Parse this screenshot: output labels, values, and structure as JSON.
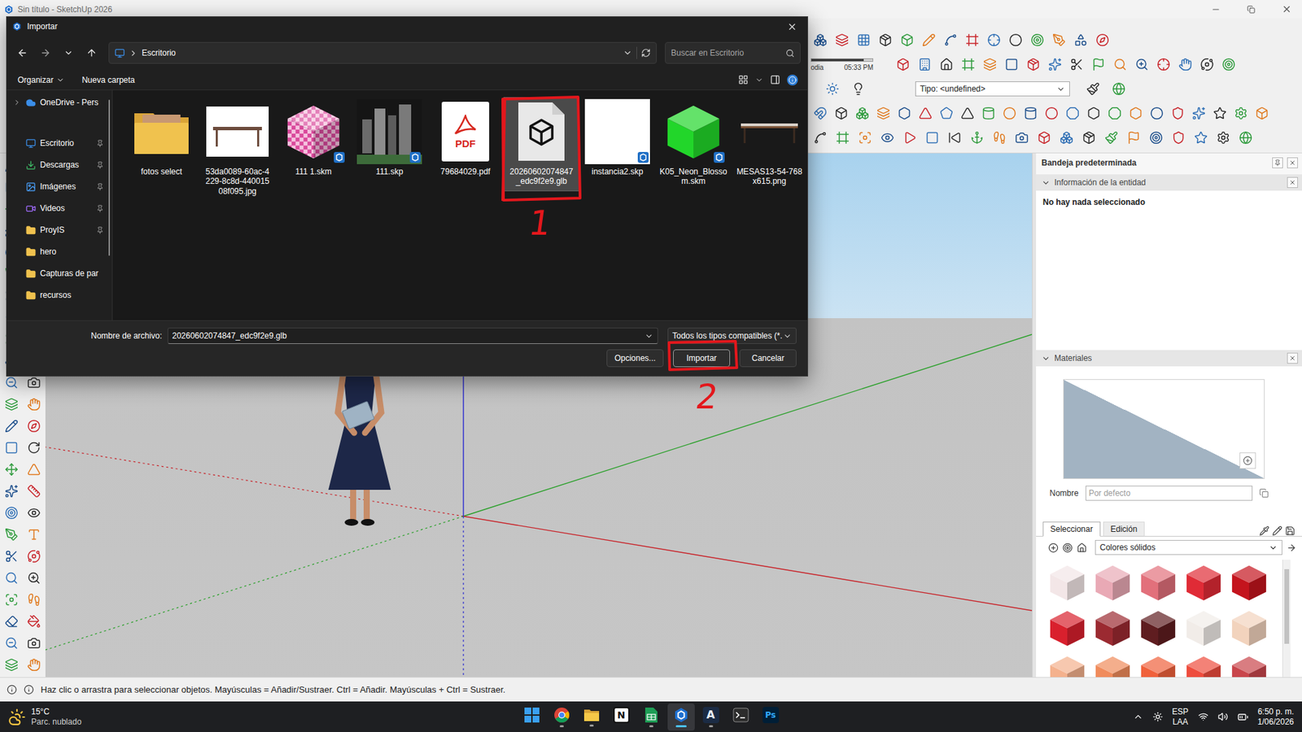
{
  "window": {
    "title": "Sin título - SketchUp 2026"
  },
  "toolbar": {
    "shadow": {
      "label": "odia",
      "time": "05:33 PM",
      "level": 0.85
    },
    "style_dropdown": "Tipo: <undefined>"
  },
  "tray": {
    "title": "Bandeja predeterminada",
    "entity_info": {
      "title": "Información de la entidad",
      "expanded": true,
      "message": "No hay nada seleccionado"
    },
    "materials": {
      "title": "Materiales",
      "expanded": true,
      "name_label": "Nombre",
      "name_placeholder": "Por defecto",
      "tabs": [
        {
          "label": "Seleccionar",
          "selected": true
        },
        {
          "label": "Edición",
          "selected": false
        }
      ],
      "library": "Colores sólidos",
      "swatches": [
        {
          "color": "#f3e6e7"
        },
        {
          "color": "#e9a9b5"
        },
        {
          "color": "#e2707b"
        },
        {
          "color": "#e02b36"
        },
        {
          "color": "#c4141d"
        },
        {
          "color": "#d9202d"
        },
        {
          "color": "#9b2a31"
        },
        {
          "color": "#5f1d20"
        },
        {
          "color": "#f1ece8"
        },
        {
          "color": "#f2d3bd"
        },
        {
          "color": "#f4b18d"
        },
        {
          "color": "#f08b5b"
        },
        {
          "color": "#f0613b"
        },
        {
          "color": "#ee4c3d"
        },
        {
          "color": "#c9454b"
        }
      ]
    }
  },
  "status_bar": {
    "message": "Haz clic o arrastra para seleccionar objetos. Mayúsculas = Añadir/Sustraer. Ctrl = Añadir. Mayúsculas + Ctrl = Sustraer."
  },
  "dialog": {
    "title": "Importar",
    "path": "Escritorio",
    "search_placeholder": "Buscar en Escritorio",
    "commands": [
      "Organizar",
      "Nueva carpeta"
    ],
    "sidebar": [
      {
        "label": "OneDrive - Pers",
        "kind": "cloud",
        "pinned": false,
        "expandable": true
      },
      {
        "label": "Escritorio",
        "kind": "desktop",
        "pinned": true,
        "expandable": false
      },
      {
        "label": "Descargas",
        "kind": "download",
        "pinned": true,
        "expandable": false
      },
      {
        "label": "Imágenes",
        "kind": "images",
        "pinned": true,
        "expandable": false
      },
      {
        "label": "Videos",
        "kind": "videos",
        "pinned": true,
        "expandable": false
      },
      {
        "label": "ProyIS",
        "kind": "folder",
        "pinned": true,
        "expandable": false
      },
      {
        "label": "hero",
        "kind": "folder",
        "pinned": false,
        "expandable": false
      },
      {
        "label": "Capturas de par",
        "kind": "folder",
        "pinned": false,
        "expandable": false
      },
      {
        "label": "recursos",
        "kind": "folder",
        "pinned": false,
        "expandable": false
      }
    ],
    "files": [
      {
        "name": "fotos select",
        "kind": "folder",
        "selected": false
      },
      {
        "name": "53da0089-60ac-4229-8c8d-44001508f095.jpg",
        "kind": "photo",
        "selected": false
      },
      {
        "name": "111 1.skm",
        "kind": "checker-material",
        "selected": false
      },
      {
        "name": "111.skp",
        "kind": "city-model",
        "selected": false
      },
      {
        "name": "79684029.pdf",
        "kind": "pdf",
        "badge": "PDF",
        "selected": false
      },
      {
        "name": "20260602074847_edc9f2e9.glb",
        "kind": "glb",
        "selected": true
      },
      {
        "name": "instancia2.skp",
        "kind": "blank-model",
        "selected": false
      },
      {
        "name": "K05_Neon_Blossom.skm",
        "kind": "green-material",
        "selected": false
      },
      {
        "name": "MESAS13-54-768x615.png",
        "kind": "table-image",
        "selected": false
      }
    ],
    "filename_label": "Nombre de archivo:",
    "filename": "20260602074847_edc9f2e9.glb",
    "filter": "Todos los tipos compatibles (*.",
    "buttons": [
      {
        "label": "Opciones...",
        "primary": false
      },
      {
        "label": "Importar",
        "primary": true
      },
      {
        "label": "Cancelar",
        "primary": false
      }
    ]
  },
  "annotations": [
    {
      "label": "1"
    },
    {
      "label": "2"
    }
  ],
  "taskbar": {
    "weather": {
      "temp": "15°C",
      "desc": "Parc. nublado"
    },
    "apps": [
      {
        "kind": "start",
        "running": false,
        "active": false
      },
      {
        "kind": "chrome",
        "running": true,
        "active": false
      },
      {
        "kind": "explorer",
        "running": true,
        "active": false
      },
      {
        "kind": "notion",
        "glyph": "N",
        "running": false,
        "active": false
      },
      {
        "kind": "sheet",
        "running": true,
        "active": false
      },
      {
        "kind": "sketchup",
        "running": true,
        "active": true
      },
      {
        "kind": "autocad",
        "glyph": "A",
        "running": true,
        "active": false
      },
      {
        "kind": "terminal",
        "running": false,
        "active": false
      },
      {
        "kind": "photoshop",
        "glyph": "Ps",
        "running": false,
        "active": false
      }
    ],
    "tray": {
      "lang": "ESP",
      "layout": "LAA",
      "time": "6:50 p. m.",
      "date": "1/06/2026"
    }
  }
}
